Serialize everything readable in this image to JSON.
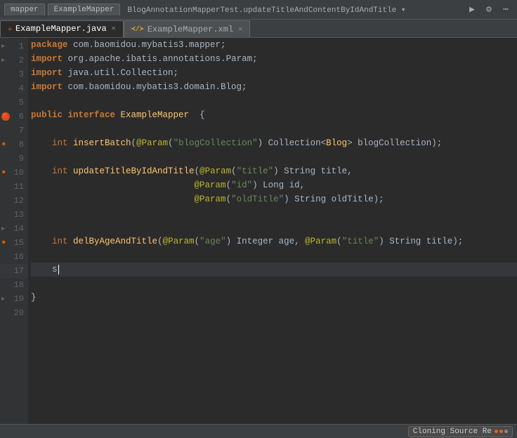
{
  "topbar": {
    "tabs": [
      {
        "id": "mapper",
        "label": "mapper",
        "active": false
      },
      {
        "id": "examplemapper",
        "label": "ExampleMapper",
        "active": false
      }
    ],
    "breadcrumb": "BlogAnnotationMapperTest.updateTitleAndContentByIdAndTitle",
    "run_icon": "▶",
    "settings_icon": "⚙",
    "more_icon": "…"
  },
  "filetabs": [
    {
      "id": "java",
      "label": "ExampleMapper.java",
      "type": "java",
      "active": true
    },
    {
      "id": "xml",
      "label": "ExampleMapper.xml",
      "type": "xml",
      "active": false
    }
  ],
  "lines": [
    {
      "num": 1,
      "has_fold": true,
      "content": "package com.baomidou.mybatis3.mapper;"
    },
    {
      "num": 2,
      "has_fold": false,
      "content": "import org.apache.ibatis.annotations.Param;"
    },
    {
      "num": 3,
      "has_fold": false,
      "content": "import java.util.Collection;"
    },
    {
      "num": 4,
      "has_fold": false,
      "content": "import com.baomidou.mybatis3.domain.Blog;"
    },
    {
      "num": 5,
      "has_fold": false,
      "content": ""
    },
    {
      "num": 6,
      "has_fold": false,
      "content": "public interface ExampleMapper  {",
      "has_bean": true,
      "has_run": true
    },
    {
      "num": 7,
      "has_fold": false,
      "content": ""
    },
    {
      "num": 8,
      "has_fold": false,
      "content": "    int insertBatch(@Param(\"blogCollection\") Collection<Blog> blogCollection);",
      "has_bean": true
    },
    {
      "num": 9,
      "has_fold": false,
      "content": ""
    },
    {
      "num": 10,
      "has_fold": false,
      "content": "    int updateTitleByIdAndTitle(@Param(\"title\") String title,",
      "has_bean": true
    },
    {
      "num": 11,
      "has_fold": false,
      "content": "                               @Param(\"id\") Long id,"
    },
    {
      "num": 12,
      "has_fold": false,
      "content": "                               @Param(\"oldTitle\") String oldTitle;"
    },
    {
      "num": 13,
      "has_fold": false,
      "content": ""
    },
    {
      "num": 14,
      "has_fold": true,
      "content": ""
    },
    {
      "num": 15,
      "has_fold": false,
      "content": "    int delByAgeAndTitle(@Param(\"age\") Integer age, @Param(\"title\") String title);",
      "has_bean": true
    },
    {
      "num": 16,
      "has_fold": false,
      "content": ""
    },
    {
      "num": 17,
      "has_fold": false,
      "content": "    s",
      "active": true
    },
    {
      "num": 18,
      "has_fold": false,
      "content": ""
    },
    {
      "num": 19,
      "has_fold": true,
      "content": "}"
    },
    {
      "num": 20,
      "has_fold": false,
      "content": ""
    }
  ],
  "statusbar": {
    "cloning_label": "Cloning Source Re",
    "dot1": "orange",
    "dot2": "orange",
    "dot3": "gray"
  }
}
